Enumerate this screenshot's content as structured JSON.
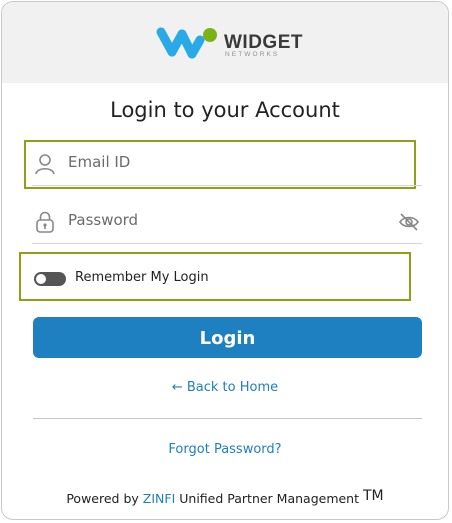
{
  "brand": {
    "name": "WIDGET",
    "sub": "NETWORKS",
    "colors": {
      "blue": "#29a9e8",
      "green": "#7ab317"
    }
  },
  "form": {
    "title": "Login to your Account",
    "email_placeholder": "Email ID",
    "password_placeholder": "Password",
    "remember_label": "Remember My Login",
    "remember_on": false,
    "login_label": "Login"
  },
  "links": {
    "back_home": "← Back to Home",
    "forgot_password": "Forgot Password?"
  },
  "footer": {
    "prefix": "Powered by",
    "brand": "ZINFI",
    "suffix": "Unified Partner Management",
    "trademark": "TM"
  },
  "icons": {
    "email": "user-icon",
    "password": "lock-icon",
    "reveal": "eye-slash-icon"
  }
}
